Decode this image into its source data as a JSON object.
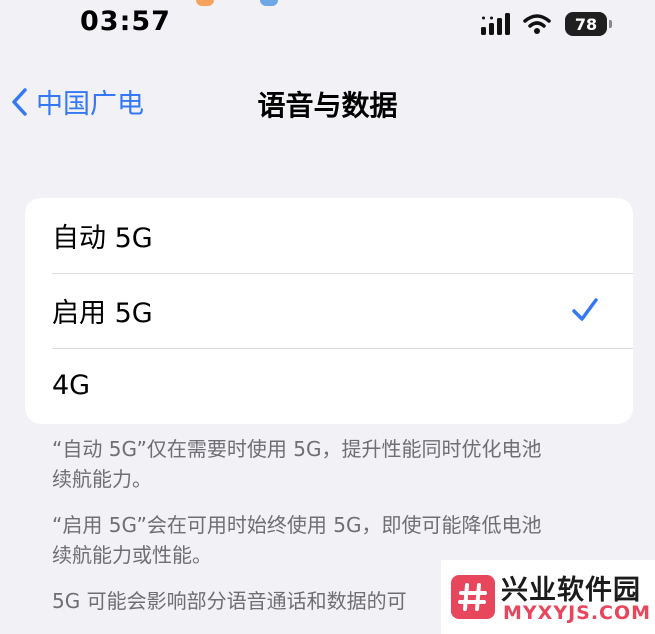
{
  "status_bar": {
    "time": "03:57",
    "battery": "78"
  },
  "nav": {
    "back_label": "中国广电",
    "title": "语音与数据"
  },
  "options": [
    {
      "label": "自动 5G",
      "selected": false
    },
    {
      "label": "启用 5G",
      "selected": true
    },
    {
      "label": "4G",
      "selected": false
    }
  ],
  "footer": {
    "note1": "“自动 5G”仅在需要时使用 5G，提升性能同时优化电池\n续航能力。",
    "note2": "“启用 5G”会在可用时始终使用 5G，即使可能降低电池\n续航能力或性能。",
    "note3": "5G 可能会影响部分语音通话和数据的可"
  },
  "watermark": {
    "name": "兴业软件园",
    "url": "MYXYJS.COM"
  },
  "colors": {
    "accent": "#3478f6",
    "background": "#f2f1f6",
    "watermark": "#e8465d"
  }
}
